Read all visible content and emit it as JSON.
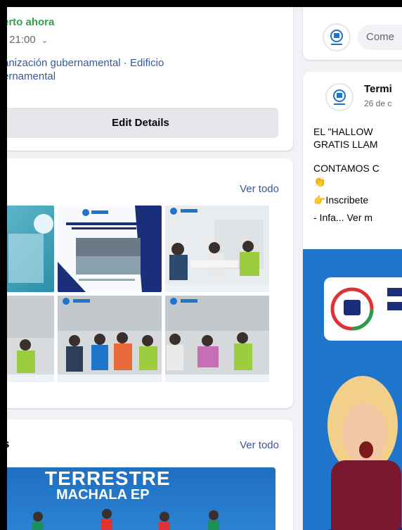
{
  "about": {
    "open_status": "erto ahora",
    "hours": "- 21:00",
    "category_line1": "anización gubernamental · Edificio",
    "category_line2": "ernamental",
    "edit_button": "Edit Details"
  },
  "photos": {
    "see_all": "Ver todo"
  },
  "videos": {
    "title_fragment": "s",
    "see_all": "Ver todo",
    "thumb_line1": "TERRESTRE",
    "thumb_line2": "MACHALA EP"
  },
  "composer": {
    "placeholder": "Come"
  },
  "post": {
    "author": "Termi",
    "date": "26 de c",
    "text_line1": "EL \"HALLOW",
    "text_line2": "GRATIS LLAM",
    "text_line3": "CONTAMOS C",
    "text_line4": "👏",
    "text_line5": "👉Inscribete",
    "text_line6_prefix": "- Infa...",
    "text_line6_more": "Ver m"
  },
  "colors": {
    "link": "#385898",
    "open": "#31a24c",
    "brand_blue": "#1f74cc"
  }
}
